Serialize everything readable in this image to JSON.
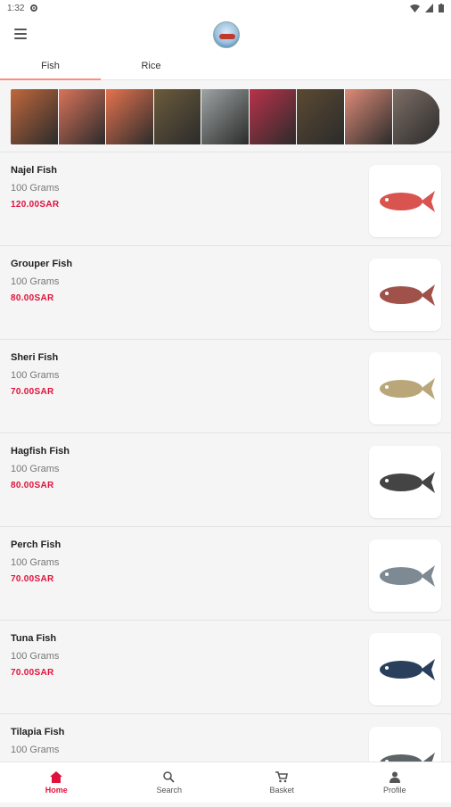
{
  "status": {
    "time": "1:32",
    "settings_icon": "gear-icon"
  },
  "appbar": {
    "menu_icon": "hamburger-menu-icon",
    "logo": "app-logo"
  },
  "tabs": [
    {
      "label": "Fish"
    },
    {
      "label": "Rice"
    }
  ],
  "banner": {
    "tiles": [
      "#c0683c",
      "#d9735a",
      "#e5734f",
      "#6b5b3b",
      "#9ea3a3",
      "#b9324a",
      "#5b4a32",
      "#dd8b78",
      "#7d6e66"
    ]
  },
  "products": [
    {
      "name": "Najel Fish",
      "weight": "100 Grams",
      "price": "120.00SAR",
      "color": "#d9534f"
    },
    {
      "name": "Grouper Fish",
      "weight": "100 Grams",
      "price": "80.00SAR",
      "color": "#a0524a"
    },
    {
      "name": "Sheri Fish",
      "weight": "100 Grams",
      "price": "70.00SAR",
      "color": "#b9a77a"
    },
    {
      "name": "Hagfish Fish",
      "weight": "100 Grams",
      "price": "80.00SAR",
      "color": "#444444"
    },
    {
      "name": "Perch Fish",
      "weight": "100 Grams",
      "price": "70.00SAR",
      "color": "#7d8a93"
    },
    {
      "name": "Tuna Fish",
      "weight": "100 Grams",
      "price": "70.00SAR",
      "color": "#2a3f5c"
    },
    {
      "name": "Tilapia Fish",
      "weight": "100 Grams",
      "price": "",
      "color": "#5d6468"
    }
  ],
  "nav": [
    {
      "label": "Home",
      "icon": "home-icon"
    },
    {
      "label": "Search",
      "icon": "search-icon"
    },
    {
      "label": "Basket",
      "icon": "cart-icon"
    },
    {
      "label": "Profile",
      "icon": "person-icon"
    }
  ],
  "colors": {
    "accent": "#e0113b",
    "tab_indicator": "#ff8a80"
  }
}
